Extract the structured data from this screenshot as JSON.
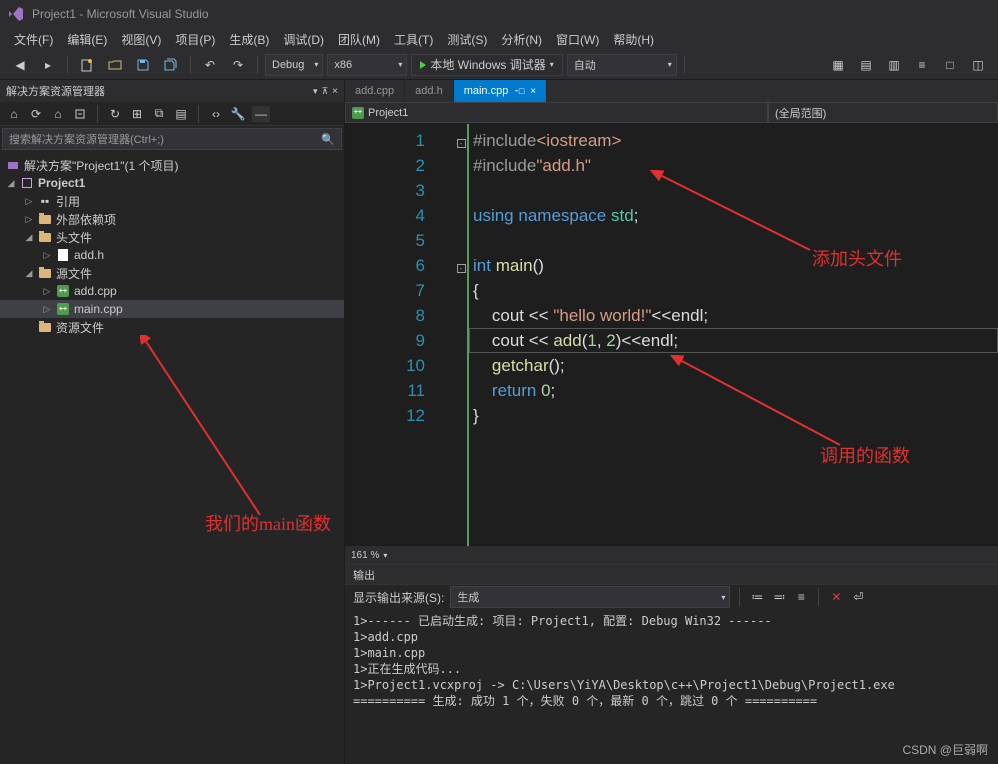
{
  "window": {
    "title": "Project1 - Microsoft Visual Studio"
  },
  "menu": [
    "文件(F)",
    "编辑(E)",
    "视图(V)",
    "项目(P)",
    "生成(B)",
    "调试(D)",
    "团队(M)",
    "工具(T)",
    "测试(S)",
    "分析(N)",
    "窗口(W)",
    "帮助(H)"
  ],
  "toolbar": {
    "config": "Debug",
    "platform": "x86",
    "run_label": "本地 Windows 调试器",
    "auto": "自动"
  },
  "explorer": {
    "title": "解决方案资源管理器",
    "search_placeholder": "搜索解决方案资源管理器(Ctrl+;)",
    "solution": "解决方案\"Project1\"(1 个项目)",
    "project": "Project1",
    "refs": "引用",
    "ext_deps": "外部依赖项",
    "headers": "头文件",
    "header_files": [
      "add.h"
    ],
    "sources": "源文件",
    "source_files": [
      "add.cpp",
      "main.cpp"
    ],
    "resources": "资源文件"
  },
  "tabs": [
    {
      "label": "add.cpp",
      "active": false
    },
    {
      "label": "add.h",
      "active": false
    },
    {
      "label": "main.cpp",
      "active": true
    }
  ],
  "navbar": {
    "project": "Project1",
    "scope": "(全局范围)"
  },
  "editor": {
    "line_count": 12,
    "lines": [
      "#include<iostream>",
      "#include\"add.h\"",
      "",
      "using namespace std;",
      "",
      "int main()",
      "{",
      "    cout << \"hello world!\"<<endl;",
      "    cout << add(1, 2)<<endl;",
      "    getchar();",
      "    return 0;",
      "}"
    ],
    "zoom": "161 %"
  },
  "output": {
    "title": "输出",
    "source_label": "显示输出来源(S):",
    "source_value": "生成",
    "lines": [
      "1>------ 已启动生成: 项目: Project1, 配置: Debug Win32 ------",
      "1>add.cpp",
      "1>main.cpp",
      "1>正在生成代码...",
      "1>Project1.vcxproj -> C:\\Users\\YiYA\\Desktop\\c++\\Project1\\Debug\\Project1.exe",
      "========== 生成: 成功 1 个，失败 0 个，最新 0 个，跳过 0 个 =========="
    ]
  },
  "annotations": {
    "header": "添加头文件",
    "call": "调用的函数",
    "main": "我们的main函数"
  },
  "watermark": "CSDN @巨弱啊"
}
